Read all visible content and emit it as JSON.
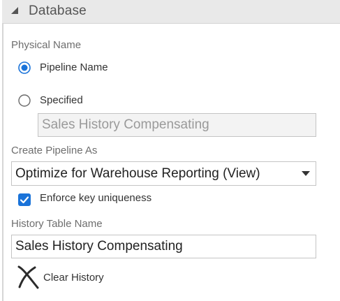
{
  "section": {
    "title": "Database",
    "collapse_icon": "triangle-down-icon"
  },
  "physical_name": {
    "label": "Physical Name",
    "options": [
      {
        "label": "Pipeline Name",
        "selected": true
      },
      {
        "label": "Specified",
        "selected": false
      }
    ],
    "specified_value": "Sales History Compensating"
  },
  "create_pipeline_as": {
    "label": "Create Pipeline As",
    "selected": "Optimize for Warehouse Reporting (View)"
  },
  "enforce_key_uniqueness": {
    "label": "Enforce key uniqueness",
    "checked": true
  },
  "history_table_name": {
    "label": "History Table Name",
    "value": "Sales History Compensating"
  },
  "clear_history": {
    "label": "Clear History",
    "icon": "clear-x-icon"
  },
  "colors": {
    "accent": "#1a73d9",
    "header_bg": "#e9e9e9",
    "label": "#6e6e6e"
  }
}
